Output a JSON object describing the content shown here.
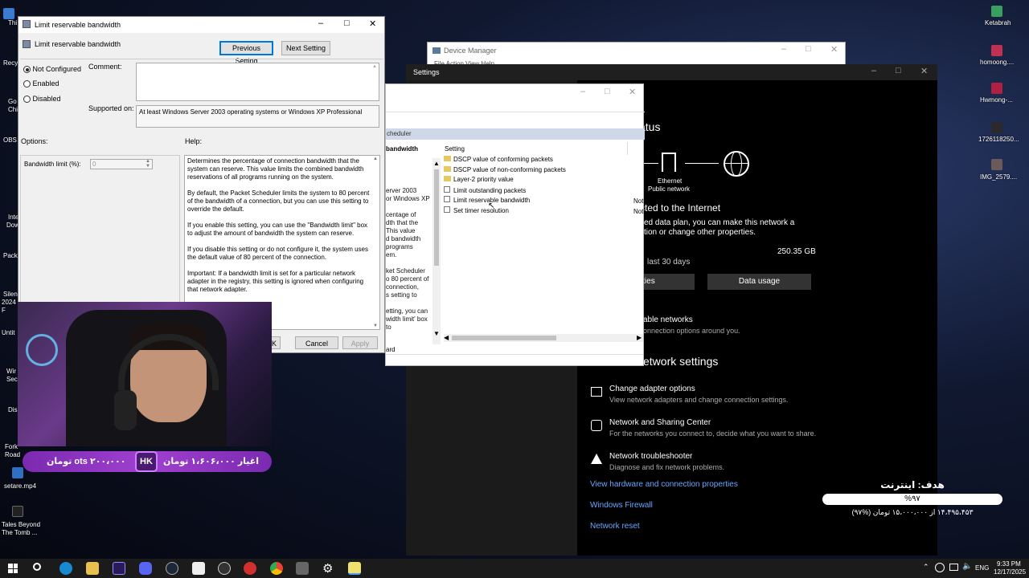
{
  "desktop": {
    "left_labels": [
      "Thi",
      "Recy",
      "Go",
      "Chi",
      "OBS",
      "Inte",
      "Dow",
      "Pack",
      "Silen",
      "2024 F",
      "Untit",
      "Wir",
      "Sec",
      "Dis",
      "Fork Road"
    ],
    "right_icons": [
      {
        "label": "Ketabrah"
      },
      {
        "label": "homoong...."
      },
      {
        "label": "Hwmong-..."
      },
      {
        "label": "1726118250..."
      },
      {
        "label": "IMG_2579...."
      }
    ],
    "bottom_icons": [
      {
        "label": "setare.mp4"
      },
      {
        "label": "Tales Beyond The Tomb ..."
      }
    ]
  },
  "device_manager": {
    "title": "Device Manager",
    "menu": "File   Action   View   Help"
  },
  "settings": {
    "title": "Settings",
    "heading": "atus",
    "network_label": "Ethernet",
    "network_sub": "Public network",
    "connected": "cted to the Internet",
    "plan_line1": "ited data plan, you can make this network a",
    "plan_line2": "ction or change other properties.",
    "usage": "250.35 GB",
    "period": "last 30 days",
    "properties_btn": "erties",
    "data_usage_btn": "Data usage",
    "avail_title": "able networks",
    "avail_sub": "onnection options around you.",
    "advanced_title": "etwork settings",
    "items": [
      {
        "title": "Change adapter options",
        "sub": "View network adapters and change connection settings."
      },
      {
        "title": "Network and Sharing Center",
        "sub": "For the networks you connect to, decide what you want to share."
      },
      {
        "title": "Network troubleshooter",
        "sub": "Diagnose and fix network problems."
      }
    ],
    "links": [
      "View hardware and connection properties",
      "Windows Firewall",
      "Network reset"
    ]
  },
  "gpe": {
    "header_strip": "cheduler",
    "left_title": "bandwidth",
    "left_lines": [
      "erver 2003",
      "or Windows XP",
      "",
      "centage of",
      "dth that the",
      "This value",
      "d bandwidth",
      "programs",
      "em.",
      "",
      "ket Scheduler",
      "o 80 percent of",
      "connection,",
      "s setting to",
      "",
      "etting, you can",
      "width limit' box to"
    ],
    "column": "Setting",
    "state_col": [
      "Not",
      "Not"
    ],
    "rows": [
      {
        "label": "DSCP value of conforming packets",
        "type": "folder"
      },
      {
        "label": "DSCP value of non-conforming packets",
        "type": "folder"
      },
      {
        "label": "Layer-2 priority value",
        "type": "folder"
      },
      {
        "label": "Limit outstanding packets",
        "type": "policy"
      },
      {
        "label": "Limit reservable bandwidth",
        "type": "policy"
      },
      {
        "label": "Set timer resolution",
        "type": "policy"
      }
    ],
    "tab": "ard"
  },
  "dialog": {
    "title": "Limit reservable bandwidth",
    "subtitle": "Limit reservable bandwidth",
    "prev_btn": "Previous Setting",
    "next_btn": "Next Setting",
    "radios": [
      {
        "label": "Not Configured",
        "checked": true
      },
      {
        "label": "Enabled",
        "checked": false
      },
      {
        "label": "Disabled",
        "checked": false
      }
    ],
    "comment_label": "Comment:",
    "supported_label": "Supported on:",
    "supported_text": "At least Windows Server 2003 operating systems or Windows XP Professional",
    "options_label": "Options:",
    "help_label": "Help:",
    "bw_label": "Bandwidth limit (%):",
    "bw_value": "0",
    "help_paragraphs": [
      "Determines the percentage of connection bandwidth that the system can reserve. This value limits the combined bandwidth reservations of all programs running on the system.",
      "By default, the Packet Scheduler limits the system to 80 percent of the bandwidth of a connection, but you can use this setting to override the default.",
      "If you enable this setting, you can use the \"Bandwidth limit\" box to adjust the amount of bandwidth the system can reserve.",
      "If you disable this setting or do not configure it, the system uses the default value of 80 percent of the connection.",
      "Important: If a bandwidth limit is set for a particular network adapter in the registry, this setting is ignored when configuring that network adapter."
    ],
    "ok_btn": "OK",
    "ok_visible": "K",
    "cancel_btn": "Cancel",
    "apply_btn": "Apply"
  },
  "stream": {
    "banner_right": "اغیار ۱،۶۰۶،۰۰۰ تومان",
    "banner_badge": "HK",
    "banner_left": "ots ۲۰۰،۰۰۰ تومان",
    "goal_title": "هدف: اینترنت",
    "goal_percent": "%۹۷",
    "goal_amount": "۱۴،۴۹۵،۴۵۳ از ۱۵،۰۰۰،۰۰۰ تومان (%۹۷)",
    "goal_progress": 0.97
  },
  "taskbar": {
    "lang": "ENG",
    "time": "9:33 PM",
    "date": "12/17/2025"
  }
}
